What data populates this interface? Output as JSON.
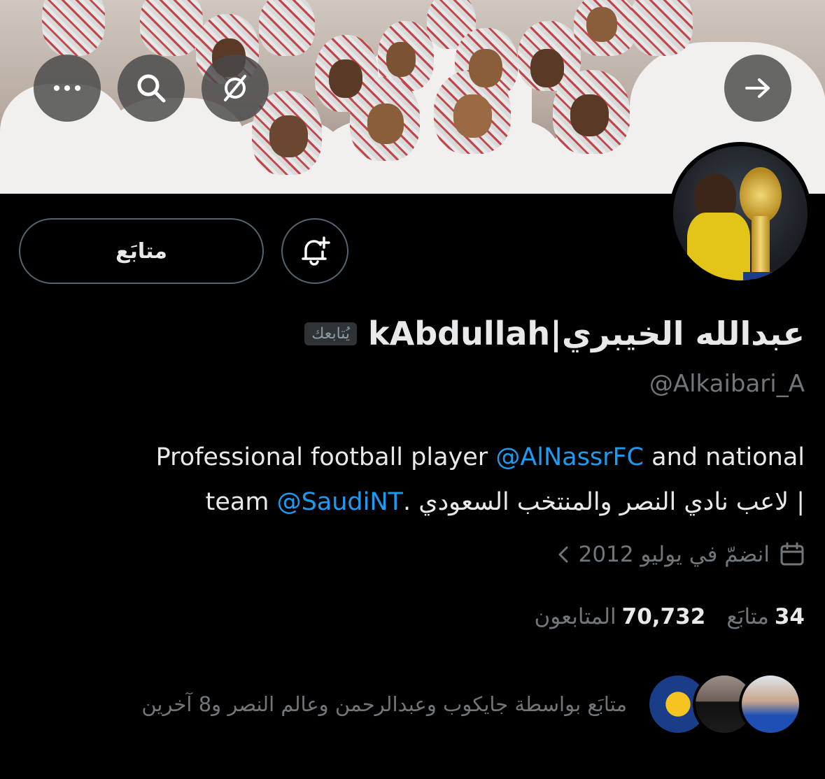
{
  "banner": {
    "buttons": {
      "back": "arrow-right-icon",
      "translate": "translate-off-icon",
      "search": "search-icon",
      "more": "more-icon"
    }
  },
  "profile": {
    "display_name": "عبدالله الخيبري|kAbdullah",
    "follows_you_badge": "يُتابعك",
    "handle": "@Alkaibari_A",
    "bio": {
      "line1_pre": "Professional football player ",
      "line1_mention": "@AlNassrFC",
      "line1_post": " and national",
      "line2_pre": "team ",
      "line2_mention": "@SaudiNT",
      "line2_post": "| لاعب نادي النصر والمنتخب السعودي ."
    },
    "joined": "انضمّ في يوليو 2012",
    "following_count": "34",
    "following_label": "متابَع",
    "followers_count": "70,732",
    "followers_label": "المتابعون",
    "followed_by": "متابَع بواسطة جايكوب وعبدالرحمن وعالم النصر و8 آخرين"
  },
  "actions": {
    "follow_label": "متابَع",
    "notify_icon": "bell-plus-icon"
  },
  "colors": {
    "background": "#000000",
    "text_primary": "#e7e9ea",
    "text_secondary": "#71767b",
    "link": "#1d9bf0",
    "border": "#536471"
  }
}
